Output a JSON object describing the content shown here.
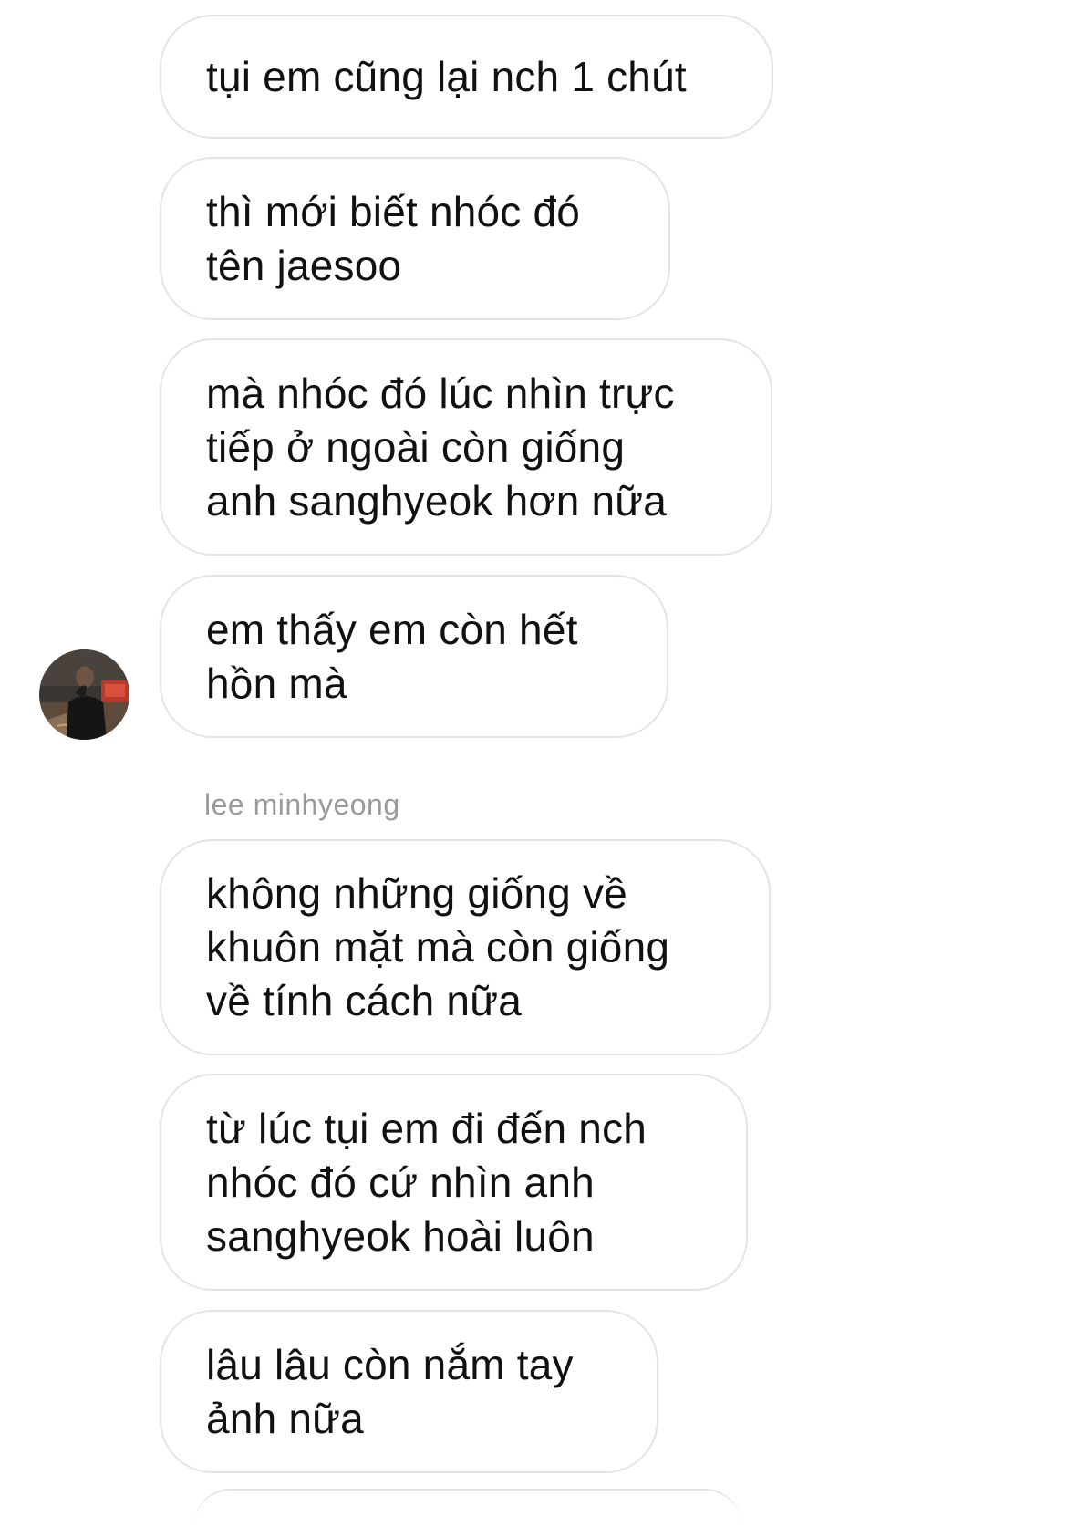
{
  "thread": {
    "messages": [
      {
        "text": "tụi em cũng lại nch 1 chút"
      },
      {
        "text": "thì mới biết nhóc đó\ntên jaesoo"
      },
      {
        "text": "mà nhóc đó lúc nhìn trực\ntiếp ở ngoài còn giống\nanh sanghyeok hơn nữa"
      },
      {
        "text": "em thấy em còn hết\nhồn mà"
      },
      {
        "text": "không những giống về\nkhuôn mặt mà còn giống\nvề tính cách nữa"
      },
      {
        "text": "từ lúc tụi em đi đến nch\nnhóc đó cứ nhìn anh\nsanghyeok hoài luôn"
      },
      {
        "text": "lâu lâu còn nắm tay\nảnh nữa"
      }
    ],
    "sender_name": "lee minhyeong"
  },
  "colors": {
    "bubble_border": "#e4e4e4",
    "text": "#111111",
    "sender_name": "#9a9a9a",
    "background": "#ffffff"
  }
}
